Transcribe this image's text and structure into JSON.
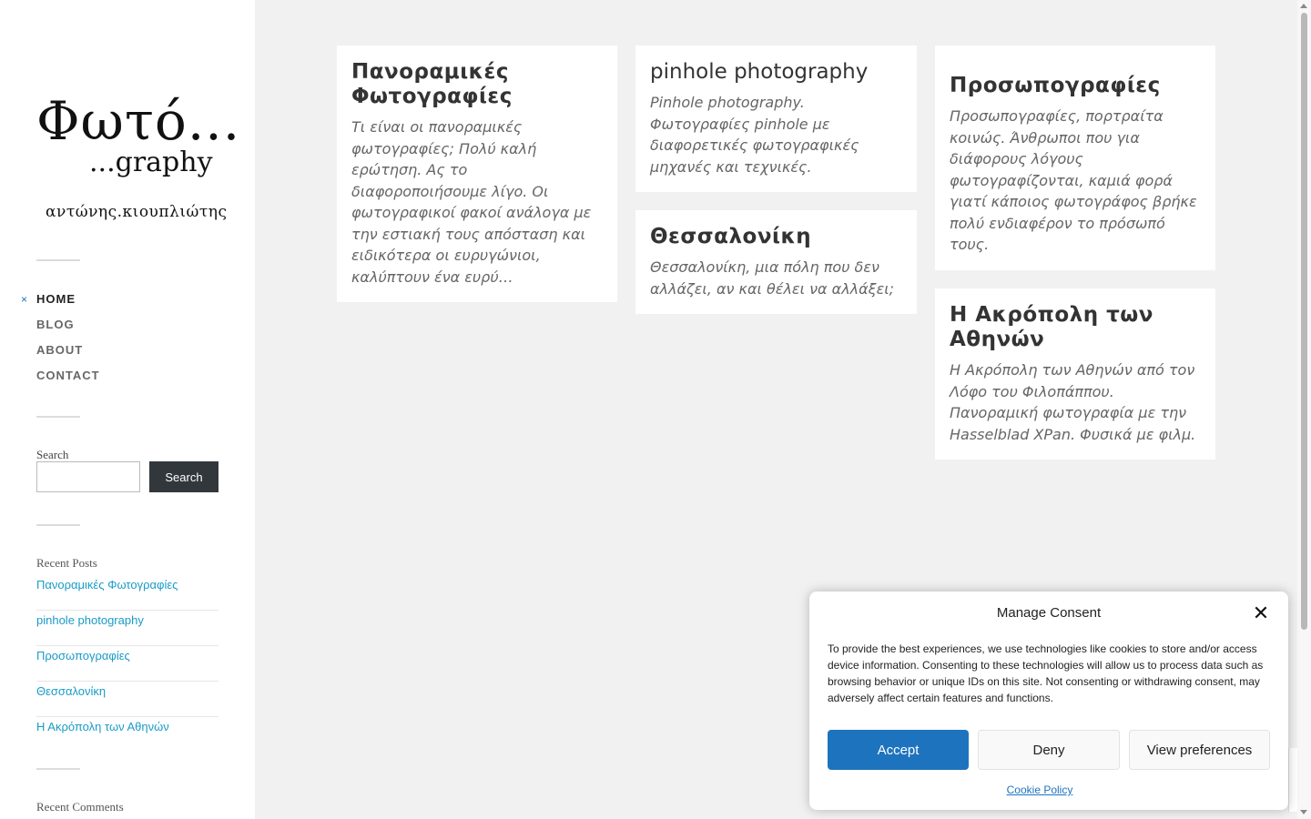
{
  "site": {
    "logo_main": "Φωτό...",
    "logo_sub": "...graphy",
    "logo_author": "αντώνης.κιουπλιώτης"
  },
  "nav": {
    "current_marker": "×",
    "items": [
      {
        "label": "HOME"
      },
      {
        "label": "BLOG"
      },
      {
        "label": "ABOUT"
      },
      {
        "label": "CONTACT"
      }
    ]
  },
  "search": {
    "label": "Search",
    "placeholder": "",
    "button_label": "Search"
  },
  "recent_posts": {
    "title": "Recent Posts",
    "items": [
      "Πανοραμικές Φωτογραφίες",
      "pinhole photography",
      "Προσωπογραφίες",
      "Θεσσαλονίκη",
      "Η Ακρόπολη των Αθηνών"
    ]
  },
  "recent_comments": {
    "title": "Recent Comments"
  },
  "posts": [
    {
      "title": "Πανοραμικές Φωτογραφίες",
      "excerpt": "Τι είναι οι πανοραμικές φωτογραφίες; Πολύ καλή ερώτηση. Ας το διαφοροποιήσουμε λίγο. Οι φωτογραφικοί φακοί ανάλογα με την εστιακή τους απόσταση και ειδικότερα οι ευρυγώνιοι, καλύπτουν ένα ευρύ…"
    },
    {
      "title": "pinhole photography",
      "excerpt": "Pinhole photography. Φωτογραφίες pinhole με διαφορετικές φωτογραφικές μηχανές και τεχνικές."
    },
    {
      "title": "Θεσσαλονίκη",
      "excerpt": "Θεσσαλονίκη, μια πόλη που δεν αλλάζει, αν και θέλει να αλλάξει;"
    },
    {
      "title": "Προσωπογραφίες",
      "excerpt": "Προσωπογραφίες, πορτραίτα κοινώς. Άνθρωποι που για διάφορους λόγους φωτογραφίζονται, καμιά φορά γιατί κάποιος φωτογράφος βρήκε πολύ ενδιαφέρον το πρόσωπό τους."
    },
    {
      "title": "Η Ακρόπολη των Αθηνών",
      "excerpt": "Η Ακρόπολη των Αθηνών από τον Λόφο του Φιλοπάππου. Πανοραμική φωτογραφία με την Hasselblad XPan. Φυσικά με φιλμ."
    }
  ],
  "consent": {
    "title": "Manage Consent",
    "close_glyph": "✕",
    "text": "To provide the best experiences, we use technologies like cookies to store and/or access device information. Consenting to these technologies will allow us to process data such as browsing behavior or unique IDs on this site. Not consenting or withdrawing consent, may adversely affect certain features and functions.",
    "accept_label": "Accept",
    "deny_label": "Deny",
    "preferences_label": "View preferences",
    "policy_link": "Cookie Policy"
  },
  "colors": {
    "accent": "#1e73be",
    "link": "#1a9bc7",
    "background": "#f1f1f1",
    "button_dark": "#32373c"
  }
}
